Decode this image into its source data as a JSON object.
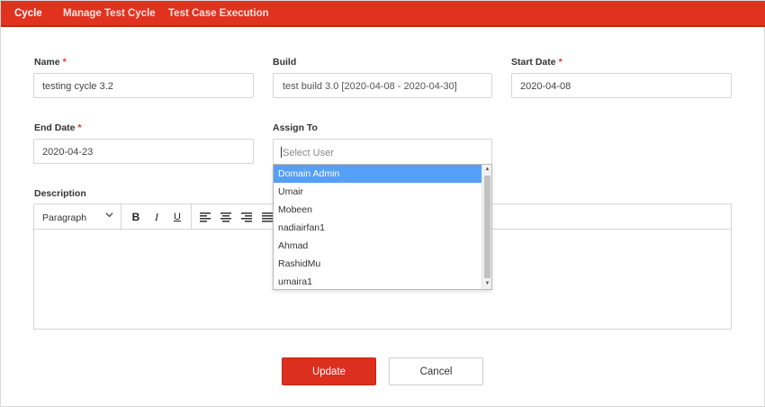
{
  "nav": {
    "tabs": [
      {
        "label": "Cycle",
        "active": true
      },
      {
        "label": "Manage Test Cycle",
        "active": false
      },
      {
        "label": "Test Case Execution",
        "active": false
      }
    ]
  },
  "form": {
    "name": {
      "label": "Name",
      "required_mark": "*",
      "value": "testing cycle 3.2"
    },
    "build": {
      "label": "Build",
      "value": "test build 3.0 [2020-04-08 - 2020-04-30]"
    },
    "start_date": {
      "label": "Start Date",
      "required_mark": "*",
      "value": "2020-04-08"
    },
    "end_date": {
      "label": "End Date",
      "required_mark": "*",
      "value": "2020-04-23"
    },
    "assign_to": {
      "label": "Assign To",
      "placeholder": "Select User",
      "options": [
        "Domain Admin",
        "Umair",
        "Mobeen",
        "nadiairfan1",
        "Ahmad",
        "RashidMu",
        "umaira1"
      ],
      "highlighted": "Domain Admin"
    },
    "description": {
      "label": "Description",
      "format_select": "Paragraph",
      "toolbar_icons": [
        "bold-icon",
        "italic-icon",
        "underline-icon",
        "align-left-icon",
        "align-center-icon",
        "align-right-icon",
        "align-justify-icon"
      ]
    }
  },
  "actions": {
    "update_label": "Update",
    "cancel_label": "Cancel"
  },
  "colors": {
    "brand_red": "#e0321f",
    "highlight_blue": "#569ff7"
  }
}
